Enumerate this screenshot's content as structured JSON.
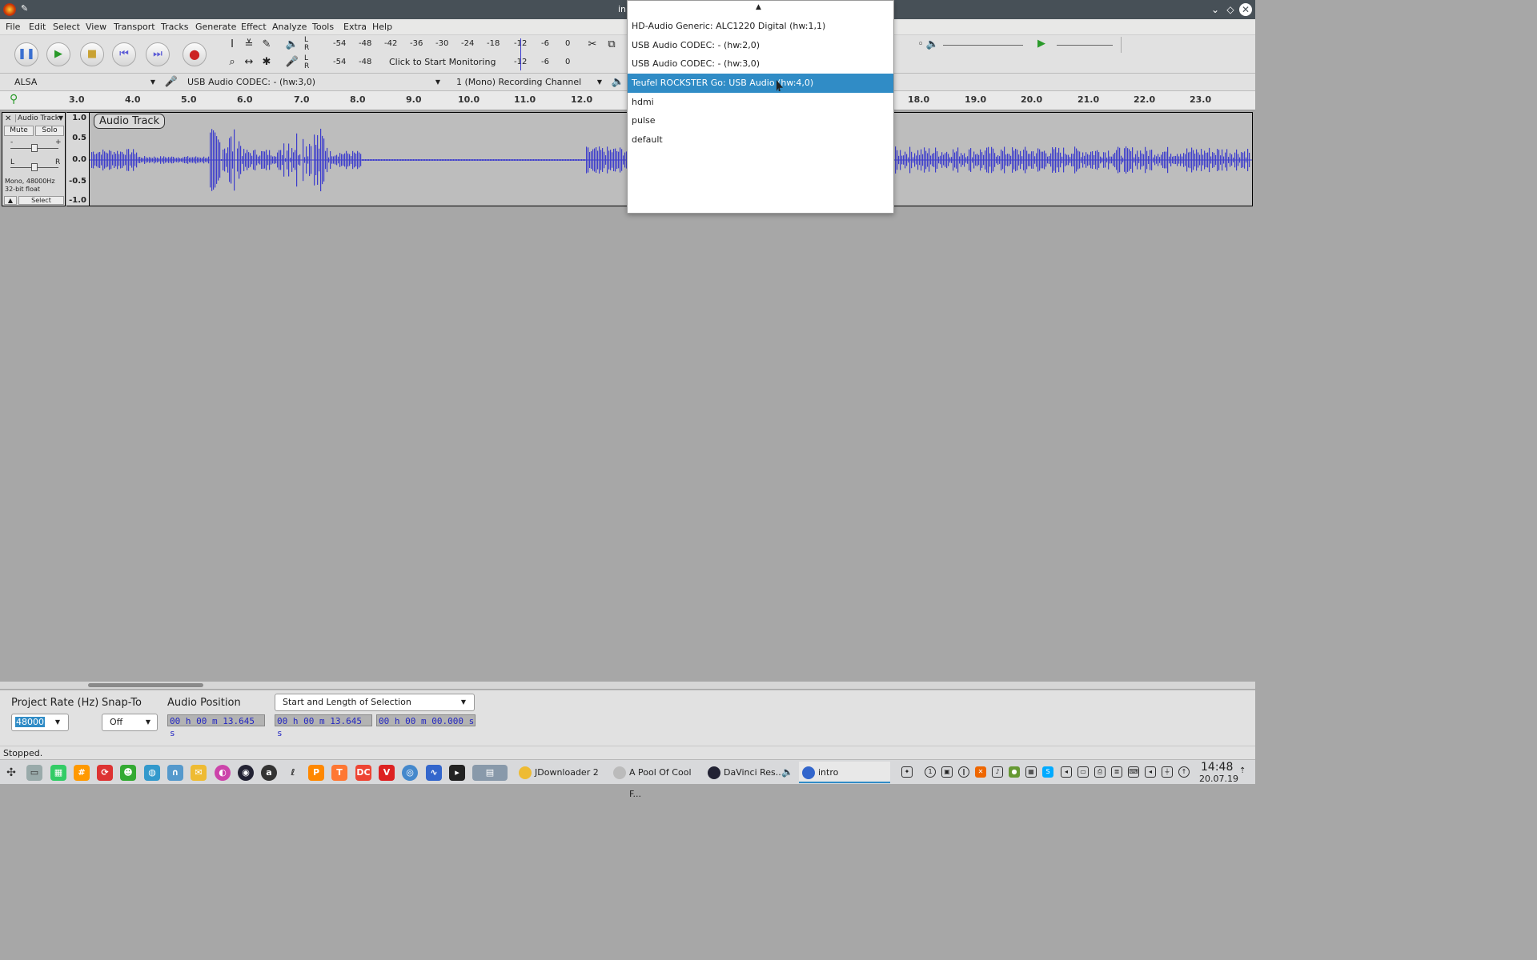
{
  "window": {
    "title": "in"
  },
  "menu": [
    "File",
    "Edit",
    "Select",
    "View",
    "Transport",
    "Tracks",
    "Generate",
    "Effect",
    "Analyze",
    "Tools",
    "Extra",
    "Help"
  ],
  "meters": {
    "playback_ticks": [
      "-54",
      "-48",
      "-42",
      "-36",
      "-30",
      "-24",
      "-18",
      "-12",
      "-6",
      "0"
    ],
    "record_ticks_left": [
      "-54",
      "-48"
    ],
    "record_hint": "Click to Start Monitoring",
    "record_ticks_right": [
      "-12",
      "-6",
      "0"
    ],
    "lr": [
      "L",
      "R"
    ]
  },
  "device": {
    "host": "ALSA",
    "recording_device": "USB Audio CODEC: - (hw:3,0)",
    "channels": "1 (Mono) Recording Channel"
  },
  "ruler": [
    "3.0",
    "4.0",
    "5.0",
    "6.0",
    "7.0",
    "8.0",
    "9.0",
    "10.0",
    "11.0",
    "12.0",
    "18.0",
    "19.0",
    "20.0",
    "21.0",
    "22.0",
    "23.0"
  ],
  "track": {
    "name": "Audio Track",
    "label": "Audio Track",
    "mute": "Mute",
    "solo": "Solo",
    "info1": "Mono, 48000Hz",
    "info2": "32-bit float",
    "select": "Select",
    "gain_minus": "-",
    "gain_plus": "+",
    "pan_l": "L",
    "pan_r": "R",
    "scale": [
      "1.0",
      "0.5",
      "0.0",
      "-0.5",
      "-1.0"
    ]
  },
  "dropdown": {
    "items": [
      "HD-Audio Generic: ALC1220 Digital (hw:1,1)",
      "USB Audio CODEC: - (hw:2,0)",
      "USB Audio CODEC: - (hw:3,0)",
      "Teufel ROCKSTER Go: USB Audio (hw:4,0)",
      "hdmi",
      "pulse",
      "default"
    ],
    "selected": "Teufel ROCKSTER Go: USB Audio (hw:4,0)"
  },
  "selection_bar": {
    "project_rate_label": "Project Rate (Hz)",
    "project_rate_value": "48000",
    "snap_label": "Snap-To",
    "snap_value": "Off",
    "audio_pos_label": "Audio Position",
    "audio_pos_value": "00 h 00 m 13.645 s",
    "selection_mode": "Start and Length of Selection",
    "sel_start": "00 h 00 m 13.645 s",
    "sel_length": "00 h 00 m 00.000 s"
  },
  "status": "Stopped.",
  "taskbar": {
    "tasks": [
      "JDownloader 2",
      "A Pool Of Cool F...",
      "DaVinci Res...",
      "intro"
    ],
    "time": "14:48",
    "date": "20.07.19"
  },
  "colors": {
    "accent": "#308cc6",
    "waveform": "#3c3ccc",
    "titlebar": "#475057"
  }
}
